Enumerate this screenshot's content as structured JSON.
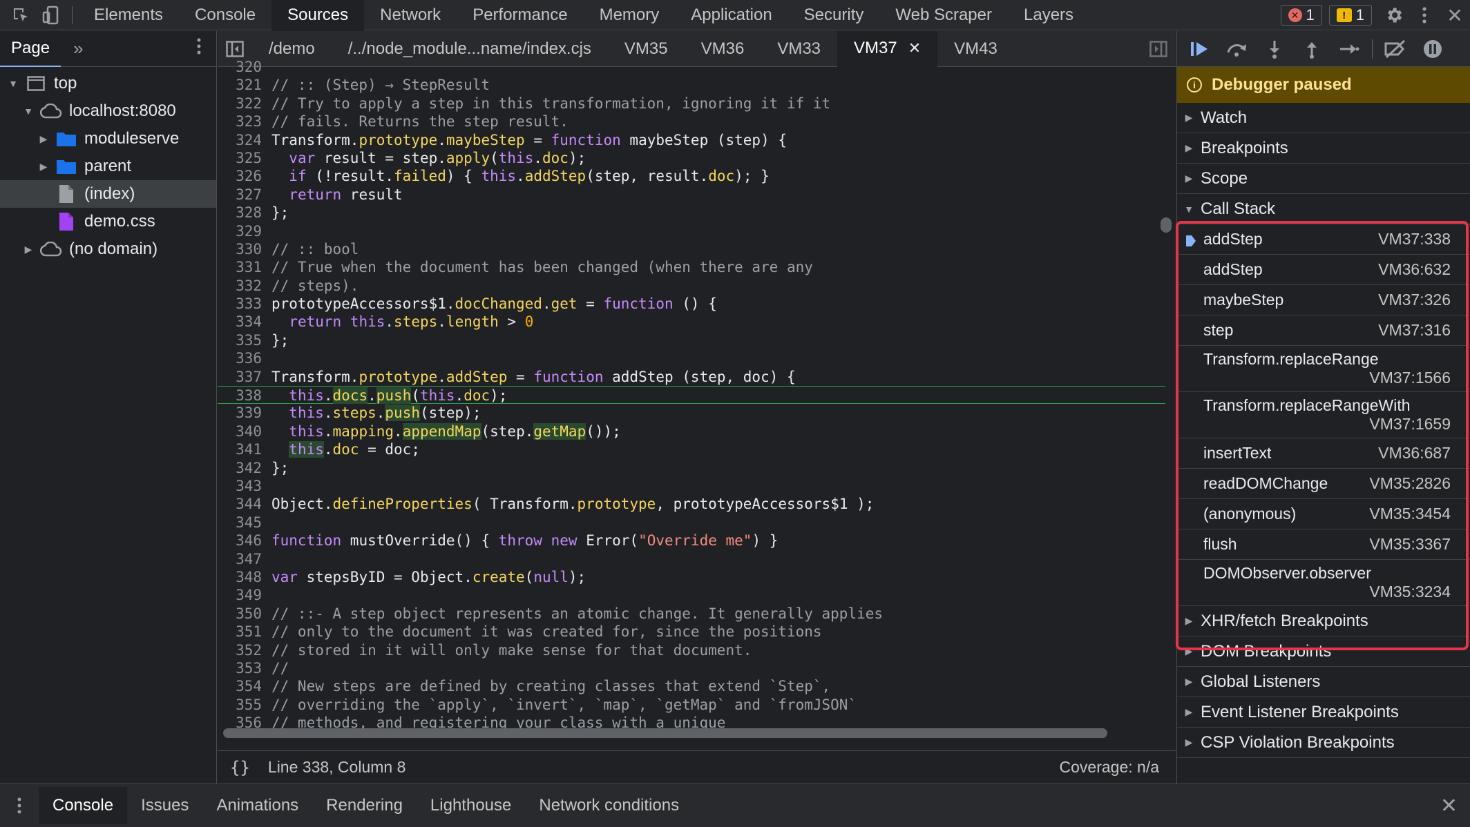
{
  "toolbar": {
    "tabs": [
      "Elements",
      "Console",
      "Sources",
      "Network",
      "Performance",
      "Memory",
      "Application",
      "Security",
      "Web Scraper",
      "Layers"
    ],
    "active_tab": "Sources",
    "error_count": "1",
    "warning_count": "1"
  },
  "navigator": {
    "tab_label": "Page",
    "tree": [
      {
        "label": "top",
        "depth": 0,
        "kind": "frame",
        "expanded": true
      },
      {
        "label": "localhost:8080",
        "depth": 1,
        "kind": "cloud",
        "expanded": true
      },
      {
        "label": "moduleserve",
        "depth": 2,
        "kind": "folder",
        "expanded": false
      },
      {
        "label": "parent",
        "depth": 2,
        "kind": "folder",
        "expanded": false
      },
      {
        "label": "(index)",
        "depth": 2,
        "kind": "file",
        "selected": true
      },
      {
        "label": "demo.css",
        "depth": 2,
        "kind": "css"
      },
      {
        "label": "(no domain)",
        "depth": 1,
        "kind": "cloud",
        "expanded": false
      }
    ]
  },
  "editor": {
    "tabs": [
      "/demo",
      "/../node_module...name/index.cjs",
      "VM35",
      "VM36",
      "VM33",
      "VM37",
      "VM43"
    ],
    "active_tab": "VM37",
    "status": {
      "position": "Line 338, Column 8",
      "coverage": "Coverage: n/a"
    },
    "first_line": 320,
    "exec_line": 338,
    "lines": [
      [
        {
          "t": "// :: (Step) → StepResult",
          "c": "cm"
        }
      ],
      [
        {
          "t": "// Try to apply a step in this transformation, ignoring it if it",
          "c": "cm"
        }
      ],
      [
        {
          "t": "// fails. Returns the step result.",
          "c": "cm"
        }
      ],
      [
        {
          "t": "Transform."
        },
        {
          "t": "prototype",
          "c": "pr"
        },
        {
          "t": "."
        },
        {
          "t": "maybeStep",
          "c": "pr"
        },
        {
          "t": " = "
        },
        {
          "t": "function",
          "c": "kw"
        },
        {
          "t": " maybeStep (step) {"
        }
      ],
      [
        {
          "t": "  "
        },
        {
          "t": "var",
          "c": "kw"
        },
        {
          "t": " result = step."
        },
        {
          "t": "apply",
          "c": "pr"
        },
        {
          "t": "("
        },
        {
          "t": "this",
          "c": "kw"
        },
        {
          "t": "."
        },
        {
          "t": "doc",
          "c": "pr"
        },
        {
          "t": ");"
        }
      ],
      [
        {
          "t": "  "
        },
        {
          "t": "if",
          "c": "kw"
        },
        {
          "t": " (!result."
        },
        {
          "t": "failed",
          "c": "pr"
        },
        {
          "t": ") { "
        },
        {
          "t": "this",
          "c": "kw"
        },
        {
          "t": "."
        },
        {
          "t": "addStep",
          "c": "pr"
        },
        {
          "t": "(step, result."
        },
        {
          "t": "doc",
          "c": "pr"
        },
        {
          "t": "); }"
        }
      ],
      [
        {
          "t": "  "
        },
        {
          "t": "return",
          "c": "kw"
        },
        {
          "t": " result"
        }
      ],
      [
        {
          "t": "};"
        }
      ],
      [
        {
          "t": ""
        }
      ],
      [
        {
          "t": "// :: bool",
          "c": "cm"
        }
      ],
      [
        {
          "t": "// True when the document has been changed (when there are any",
          "c": "cm"
        }
      ],
      [
        {
          "t": "// steps).",
          "c": "cm"
        }
      ],
      [
        {
          "t": "prototypeAccessors$1."
        },
        {
          "t": "docChanged",
          "c": "pr"
        },
        {
          "t": "."
        },
        {
          "t": "get",
          "c": "pr"
        },
        {
          "t": " = "
        },
        {
          "t": "function",
          "c": "kw"
        },
        {
          "t": " () {"
        }
      ],
      [
        {
          "t": "  "
        },
        {
          "t": "return",
          "c": "kw"
        },
        {
          "t": " "
        },
        {
          "t": "this",
          "c": "kw"
        },
        {
          "t": "."
        },
        {
          "t": "steps",
          "c": "pr"
        },
        {
          "t": "."
        },
        {
          "t": "length",
          "c": "pr"
        },
        {
          "t": " > "
        },
        {
          "t": "0",
          "c": "nm"
        }
      ],
      [
        {
          "t": "};"
        }
      ],
      [
        {
          "t": ""
        }
      ],
      [
        {
          "t": "Transform."
        },
        {
          "t": "prototype",
          "c": "pr"
        },
        {
          "t": "."
        },
        {
          "t": "addStep",
          "c": "pr"
        },
        {
          "t": " = "
        },
        {
          "t": "function",
          "c": "kw"
        },
        {
          "t": " addStep (step, doc) {"
        }
      ],
      [
        {
          "t": "  "
        },
        {
          "t": "this",
          "c": "kw"
        },
        {
          "t": "."
        },
        {
          "t": "docs",
          "c": "pr hl"
        },
        {
          "t": "."
        },
        {
          "t": "push",
          "c": "pr hl"
        },
        {
          "t": "("
        },
        {
          "t": "this",
          "c": "kw"
        },
        {
          "t": "."
        },
        {
          "t": "doc",
          "c": "pr"
        },
        {
          "t": ");"
        }
      ],
      [
        {
          "t": "  "
        },
        {
          "t": "this",
          "c": "kw"
        },
        {
          "t": "."
        },
        {
          "t": "steps",
          "c": "pr"
        },
        {
          "t": "."
        },
        {
          "t": "push",
          "c": "pr hl"
        },
        {
          "t": "(step);"
        }
      ],
      [
        {
          "t": "  "
        },
        {
          "t": "this",
          "c": "kw"
        },
        {
          "t": "."
        },
        {
          "t": "mapping",
          "c": "pr"
        },
        {
          "t": "."
        },
        {
          "t": "appendMap",
          "c": "pr hl"
        },
        {
          "t": "(step."
        },
        {
          "t": "getMap",
          "c": "pr hl"
        },
        {
          "t": "());"
        }
      ],
      [
        {
          "t": "  "
        },
        {
          "t": "this",
          "c": "kw hl"
        },
        {
          "t": "."
        },
        {
          "t": "doc",
          "c": "pr"
        },
        {
          "t": " = doc;"
        }
      ],
      [
        {
          "t": "};"
        }
      ],
      [
        {
          "t": ""
        }
      ],
      [
        {
          "t": "Object."
        },
        {
          "t": "defineProperties",
          "c": "pr"
        },
        {
          "t": "( Transform."
        },
        {
          "t": "prototype",
          "c": "pr"
        },
        {
          "t": ", prototypeAccessors$1 );"
        }
      ],
      [
        {
          "t": ""
        }
      ],
      [
        {
          "t": "function",
          "c": "kw"
        },
        {
          "t": " mustOverride() { "
        },
        {
          "t": "throw",
          "c": "kw"
        },
        {
          "t": " "
        },
        {
          "t": "new",
          "c": "kw"
        },
        {
          "t": " Error("
        },
        {
          "t": "\"Override me\"",
          "c": "st"
        },
        {
          "t": ") }"
        }
      ],
      [
        {
          "t": ""
        }
      ],
      [
        {
          "t": "var",
          "c": "kw"
        },
        {
          "t": " stepsByID = Object."
        },
        {
          "t": "create",
          "c": "pr"
        },
        {
          "t": "("
        },
        {
          "t": "null",
          "c": "kw"
        },
        {
          "t": ");"
        }
      ],
      [
        {
          "t": ""
        }
      ],
      [
        {
          "t": "// ::- A step object represents an atomic change. It generally applies",
          "c": "cm"
        }
      ],
      [
        {
          "t": "// only to the document it was created for, since the positions",
          "c": "cm"
        }
      ],
      [
        {
          "t": "// stored in it will only make sense for that document.",
          "c": "cm"
        }
      ],
      [
        {
          "t": "//",
          "c": "cm"
        }
      ],
      [
        {
          "t": "// New steps are defined by creating classes that extend `Step`,",
          "c": "cm"
        }
      ],
      [
        {
          "t": "// overriding the `apply`, `invert`, `map`, `getMap` and `fromJSON`",
          "c": "cm"
        }
      ],
      [
        {
          "t": "// methods, and registering your class with a unique",
          "c": "cm"
        }
      ]
    ]
  },
  "debugger": {
    "paused_label": "Debugger paused",
    "panes_before": [
      "Watch",
      "Breakpoints",
      "Scope"
    ],
    "call_stack_label": "Call Stack",
    "call_stack": [
      {
        "fn": "addStep",
        "loc": "VM37:338",
        "current": true
      },
      {
        "fn": "addStep",
        "loc": "VM36:632"
      },
      {
        "fn": "maybeStep",
        "loc": "VM37:326"
      },
      {
        "fn": "step",
        "loc": "VM37:316"
      },
      {
        "fn": "Transform.replaceRange",
        "loc": "VM37:1566",
        "wrap": true
      },
      {
        "fn": "Transform.replaceRangeWith",
        "loc": "VM37:1659",
        "wrap": true
      },
      {
        "fn": "insertText",
        "loc": "VM36:687"
      },
      {
        "fn": "readDOMChange",
        "loc": "VM35:2826"
      },
      {
        "fn": "(anonymous)",
        "loc": "VM35:3454"
      },
      {
        "fn": "flush",
        "loc": "VM35:3367"
      },
      {
        "fn": "DOMObserver.observer",
        "loc": "VM35:3234",
        "wrap": true
      }
    ],
    "panes_after": [
      "XHR/fetch Breakpoints",
      "DOM Breakpoints",
      "Global Listeners",
      "Event Listener Breakpoints",
      "CSP Violation Breakpoints"
    ]
  },
  "drawer": {
    "tabs": [
      "Console",
      "Issues",
      "Animations",
      "Rendering",
      "Lighthouse",
      "Network conditions"
    ],
    "active_tab": "Console"
  },
  "colors": {
    "accent": "#8ab4f8",
    "paused_bg": "#5f4a02",
    "highlight_box": "#e5354a",
    "exec_line": "#2b9d46"
  }
}
